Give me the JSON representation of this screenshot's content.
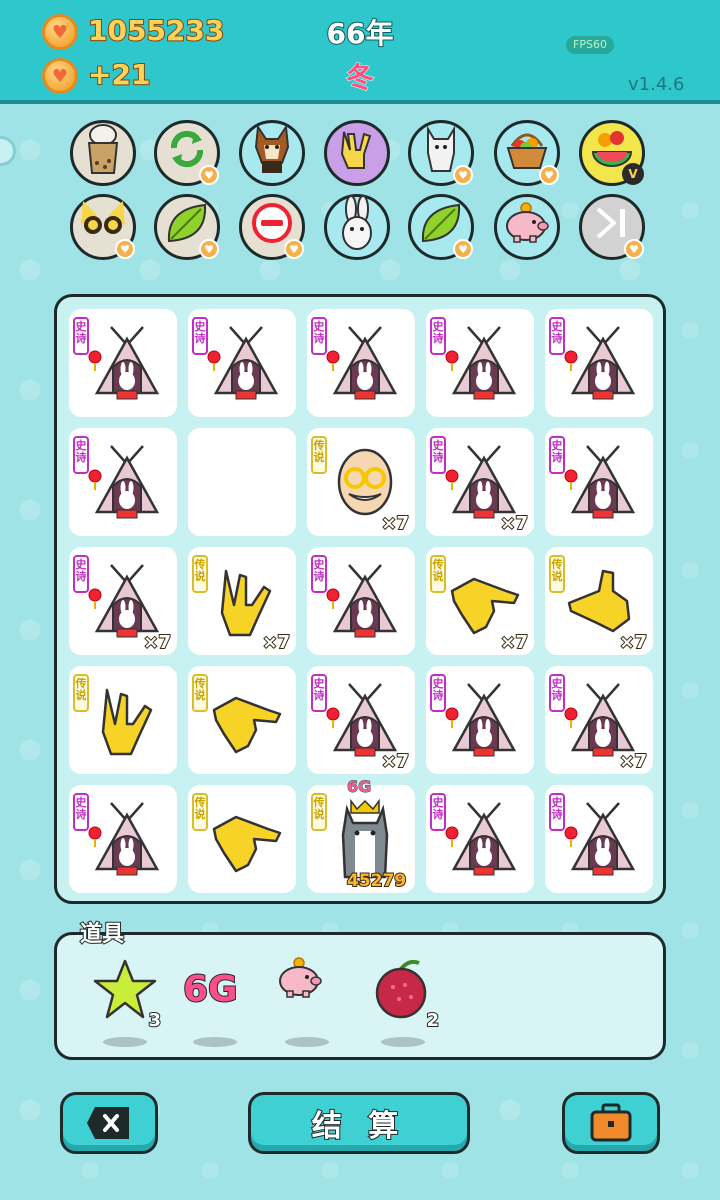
{
  "header": {
    "coins": "1055233",
    "coin_gain": "+21",
    "year": "66年",
    "season": "冬",
    "fps": "FPS60",
    "version": "v1.4.6"
  },
  "powerups": [
    {
      "name": "cup",
      "bg": "#e6e0d2",
      "heart": false
    },
    {
      "name": "refresh",
      "bg": "#e6e0d2",
      "heart": true
    },
    {
      "name": "dog",
      "bg": "#a8e9f0",
      "heart": false
    },
    {
      "name": "hand-sign",
      "bg": "#c9a0e8",
      "heart": false
    },
    {
      "name": "cat",
      "bg": "#a8e9f0",
      "heart": true
    },
    {
      "name": "fruit-basket",
      "bg": "#a8e9f0",
      "heart": true
    },
    {
      "name": "fruit-plate",
      "bg": "#f2e64a",
      "heart": false,
      "vip": "V"
    },
    {
      "name": "old-man-glasses",
      "bg": "#e6e0d2",
      "heart": true
    },
    {
      "name": "leaf",
      "bg": "#e6e0d2",
      "heart": true
    },
    {
      "name": "remove",
      "bg": "#e6e0d2",
      "heart": true
    },
    {
      "name": "rabbit",
      "bg": "#a8e9f0",
      "heart": false
    },
    {
      "name": "leaf",
      "bg": "#a8e9f0",
      "heart": true
    },
    {
      "name": "piggy-bank",
      "bg": "#a8e9f0",
      "heart": false
    },
    {
      "name": "skip",
      "bg": "#e6e0d2",
      "heart": true
    }
  ],
  "rarity_labels": {
    "epic": "史诗",
    "legend": "传说"
  },
  "board": [
    {
      "type": "tent",
      "rarity": "epic",
      "mult": ""
    },
    {
      "type": "tent",
      "rarity": "epic",
      "mult": ""
    },
    {
      "type": "tent",
      "rarity": "epic",
      "mult": ""
    },
    {
      "type": "tent",
      "rarity": "epic",
      "mult": ""
    },
    {
      "type": "tent",
      "rarity": "epic",
      "mult": ""
    },
    {
      "type": "tent",
      "rarity": "epic",
      "mult": ""
    },
    {
      "type": "empty",
      "rarity": "",
      "mult": ""
    },
    {
      "type": "oldman",
      "rarity": "legend",
      "mult": "×7"
    },
    {
      "type": "tent",
      "rarity": "epic",
      "mult": "×7"
    },
    {
      "type": "tent",
      "rarity": "epic",
      "mult": ""
    },
    {
      "type": "tent",
      "rarity": "epic",
      "mult": "×7"
    },
    {
      "type": "hand-rock",
      "rarity": "legend",
      "mult": "×7"
    },
    {
      "type": "tent",
      "rarity": "epic",
      "mult": ""
    },
    {
      "type": "hand-point",
      "rarity": "legend",
      "mult": "×7"
    },
    {
      "type": "hand-point-up",
      "rarity": "legend",
      "mult": "×7"
    },
    {
      "type": "hand-rock",
      "rarity": "legend",
      "mult": ""
    },
    {
      "type": "hand-point",
      "rarity": "legend",
      "mult": ""
    },
    {
      "type": "tent",
      "rarity": "epic",
      "mult": "×7"
    },
    {
      "type": "tent",
      "rarity": "epic",
      "mult": ""
    },
    {
      "type": "tent",
      "rarity": "epic",
      "mult": "×7"
    },
    {
      "type": "tent",
      "rarity": "epic",
      "mult": ""
    },
    {
      "type": "hand-point",
      "rarity": "legend",
      "mult": ""
    },
    {
      "type": "husky",
      "rarity": "legend",
      "mult": "",
      "top": "6G",
      "value": "45279"
    },
    {
      "type": "tent",
      "rarity": "epic",
      "mult": ""
    },
    {
      "type": "tent",
      "rarity": "epic",
      "mult": ""
    }
  ],
  "items": {
    "label": "道具",
    "list": [
      {
        "name": "star",
        "count": "3"
      },
      {
        "name": "6g",
        "text": "6G",
        "count": ""
      },
      {
        "name": "piggy-bank",
        "count": ""
      },
      {
        "name": "bayberry",
        "count": "2"
      }
    ]
  },
  "buttons": {
    "settle": "结 算"
  },
  "colors": {
    "header": "#2ec7cc",
    "background": "#9fe3e6",
    "epic": "#c22ec5",
    "legend": "#d7be2a"
  }
}
